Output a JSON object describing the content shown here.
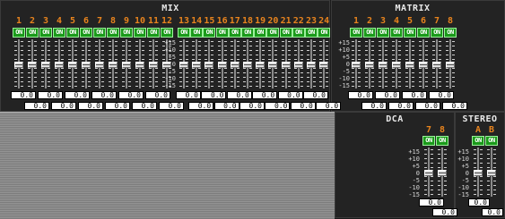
{
  "mix": {
    "title": "MIX",
    "channels": [
      "1",
      "2",
      "3",
      "4",
      "5",
      "6",
      "7",
      "8",
      "9",
      "10",
      "11",
      "12",
      "13",
      "14",
      "15",
      "16",
      "17",
      "18",
      "19",
      "20",
      "21",
      "22",
      "23",
      "24"
    ],
    "on_label": "ON",
    "values": [
      "0.0",
      "0.0",
      "0.0",
      "0.0",
      "0.0",
      "0.0",
      "0.0",
      "0.0",
      "0.0",
      "0.0",
      "0.0",
      "0.0",
      "0.0",
      "0.0",
      "0.0",
      "0.0",
      "0.0",
      "0.0",
      "0.0",
      "0.0",
      "0.0",
      "0.0",
      "0.0",
      "0.0"
    ],
    "scale": [
      "+15",
      "+10",
      "+5",
      "0",
      "-5",
      "-10",
      "-15"
    ]
  },
  "matrix": {
    "title": "MATRIX",
    "channels": [
      "1",
      "2",
      "3",
      "4",
      "5",
      "6",
      "7",
      "8"
    ],
    "on_label": "ON",
    "values": [
      "0.0",
      "0.0",
      "0.0",
      "0.0",
      "0.0",
      "0.0",
      "0.0",
      "0.0"
    ],
    "scale": [
      "+15",
      "+10",
      "+5",
      "0",
      "-5",
      "-10",
      "-15"
    ]
  },
  "dca": {
    "title": "DCA",
    "channels": [
      "7",
      "8"
    ],
    "on_label": "ON",
    "values": [
      "0.0",
      "0.0"
    ],
    "scale": [
      "+15",
      "+10",
      "+5",
      "0",
      "-5",
      "-10",
      "-15"
    ]
  },
  "stereo": {
    "title": "STEREO",
    "channels": [
      "A",
      "B"
    ],
    "on_label": "ON",
    "values": [
      "0.0",
      "0.0"
    ],
    "scale": [
      "+15",
      "+10",
      "+5",
      "0",
      "-5",
      "-10",
      "-15"
    ]
  },
  "colors": {
    "channel_number": "#e8841e",
    "on_button": "#1a9a1a",
    "background": "#232323",
    "value_box": "#ffffff",
    "striped_area": "#888888"
  }
}
